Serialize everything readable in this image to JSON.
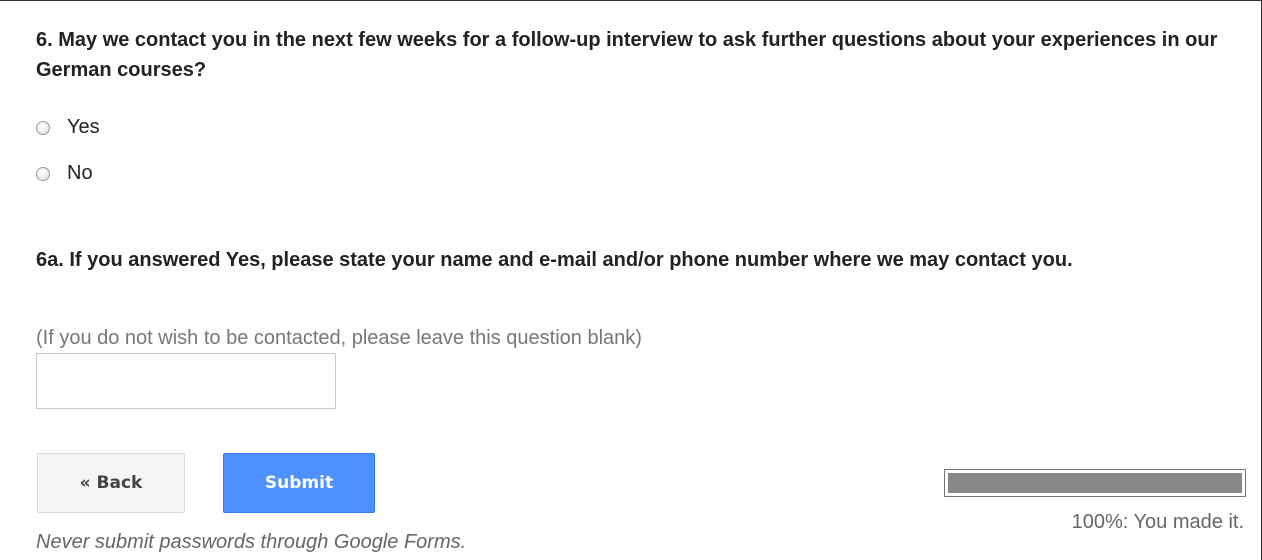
{
  "questions": {
    "q6": {
      "title": "6. May we contact you in the next few weeks for a follow-up interview to ask further questions about your experiences in our German courses?",
      "options": [
        {
          "label": "Yes",
          "selected": false
        },
        {
          "label": "No",
          "selected": false
        }
      ]
    },
    "q6a": {
      "title": "6a. If you answered Yes, please state your name and e-mail and/or phone number where we may contact you.",
      "help_text": "(If you do not wish to be contacted, please leave this question blank)",
      "value": ""
    }
  },
  "nav": {
    "back_label": "« Back",
    "submit_label": "Submit"
  },
  "progress": {
    "fraction": 1.0,
    "text": "100%: You made it."
  },
  "footer": {
    "disclaimer": "Never submit passwords through Google Forms."
  },
  "colors": {
    "submit_button": "#4d90fe",
    "progress_fill": "#888888",
    "help_text": "#777777"
  }
}
